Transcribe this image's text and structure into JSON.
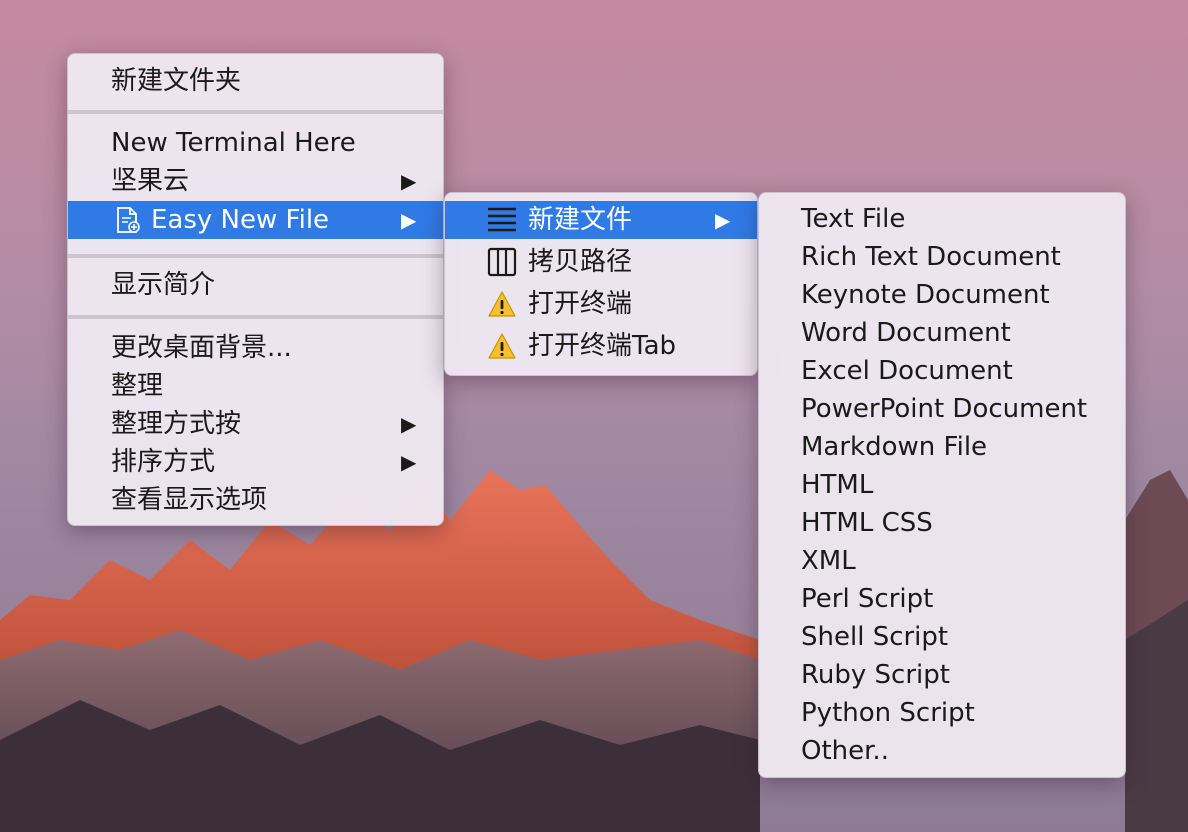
{
  "main_menu": {
    "items": [
      {
        "label": "新建文件夹"
      },
      {
        "label": "New Terminal Here"
      },
      {
        "label": "坚果云",
        "submenu": true
      },
      {
        "label": "Easy New File",
        "submenu": true,
        "active": true,
        "icon": "document-add-icon"
      },
      {
        "label": "显示简介"
      },
      {
        "label": "更改桌面背景..."
      },
      {
        "label": "整理"
      },
      {
        "label": "整理方式按",
        "submenu": true
      },
      {
        "label": "排序方式",
        "submenu": true
      },
      {
        "label": "查看显示选项"
      }
    ]
  },
  "easy_new_file_menu": {
    "items": [
      {
        "label": "新建文件",
        "submenu": true,
        "active": true,
        "icon": "menu-lines-icon"
      },
      {
        "label": "拷贝路径",
        "icon": "columns-icon"
      },
      {
        "label": "打开终端",
        "icon": "warning-icon"
      },
      {
        "label": "打开终端Tab",
        "icon": "warning-icon"
      }
    ]
  },
  "new_file_menu": {
    "items": [
      "Text File",
      "Rich Text Document",
      "Keynote Document",
      "Word Document",
      "Excel Document",
      "PowerPoint Document",
      "Markdown File",
      "HTML",
      "HTML CSS",
      "XML",
      "Perl Script",
      "Shell Script",
      "Ruby Script",
      "Python Script",
      "Other.."
    ]
  },
  "arrow_glyph": "▶",
  "colors": {
    "highlight": "#2f7ae5",
    "menu_bg": "#eee8f0"
  }
}
